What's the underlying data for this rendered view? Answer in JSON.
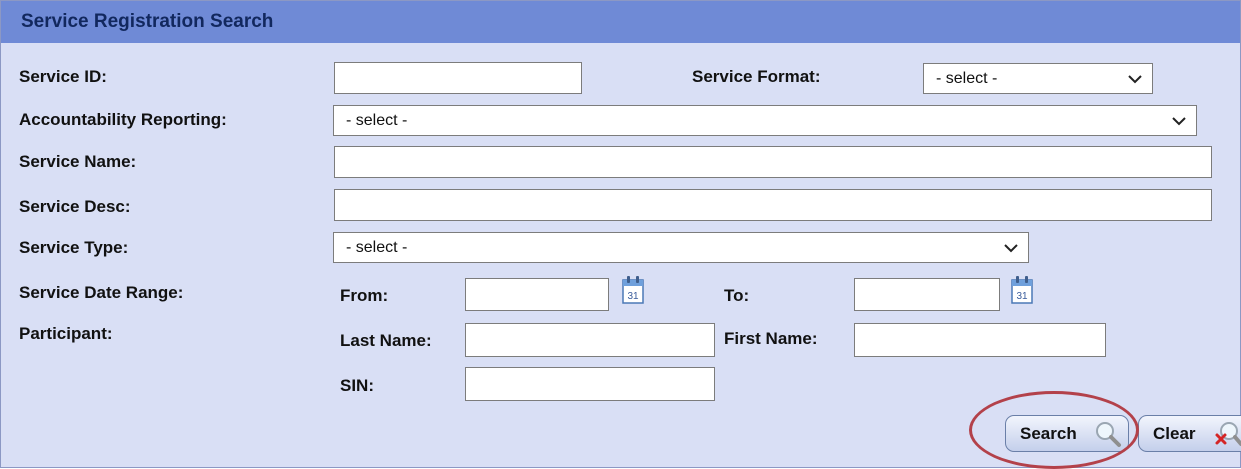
{
  "header": {
    "title": "Service Registration Search"
  },
  "fields": {
    "service_id": {
      "label": "Service ID:",
      "value": ""
    },
    "service_format": {
      "label": "Service Format:",
      "selected": "- select -"
    },
    "accountability_reporting": {
      "label": "Accountability Reporting:",
      "selected": "- select -"
    },
    "service_name": {
      "label": "Service Name:",
      "value": ""
    },
    "service_desc": {
      "label": "Service Desc:",
      "value": ""
    },
    "service_type": {
      "label": "Service Type:",
      "selected": "- select -"
    },
    "date_range": {
      "label": "Service Date Range:",
      "from_label": "From:",
      "from_value": "",
      "to_label": "To:",
      "to_value": "",
      "calendar_day": "31"
    },
    "participant": {
      "label": "Participant:",
      "last_name_label": "Last Name:",
      "last_name_value": "",
      "first_name_label": "First Name:",
      "first_name_value": "",
      "sin_label": "SIN:",
      "sin_value": ""
    }
  },
  "buttons": {
    "search_label": "Search",
    "clear_label": "Clear"
  },
  "icons": {
    "dropdown": "chevron-down-icon",
    "calendar": "calendar-icon",
    "search": "magnifier-icon",
    "clear": "magnifier-with-red-x-icon"
  },
  "colors": {
    "header_background": "#6f8ad6",
    "panel_background": "#d9dff5",
    "highlight_ring": "#b3414a",
    "header_text": "#12285e"
  }
}
